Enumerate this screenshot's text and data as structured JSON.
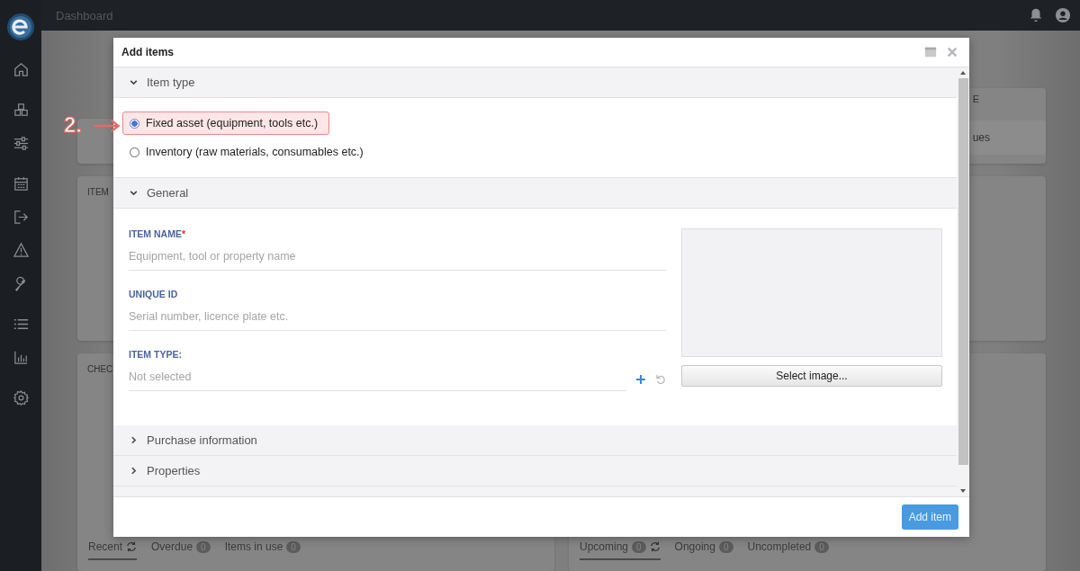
{
  "topbar": {
    "title": "Dashboard"
  },
  "dashboard": {
    "right_title": "E",
    "right_bar_text": "ues",
    "panels": [
      {
        "title": "ITEM"
      },
      {
        "title": "CHEC"
      }
    ],
    "tab_groups": [
      {
        "tabs": [
          {
            "label": "Recent",
            "selected": true,
            "refresh": true
          },
          {
            "label": "Overdue",
            "badge": "0",
            "selected": false,
            "refresh": false
          },
          {
            "label": "Items in use",
            "badge": "0",
            "selected": false,
            "refresh": false
          }
        ]
      },
      {
        "tabs": [
          {
            "label": "Upcoming",
            "badge": "0",
            "selected": true,
            "refresh": true
          },
          {
            "label": "Ongoing",
            "badge": "0",
            "selected": false,
            "refresh": false
          },
          {
            "label": "Uncompleted",
            "badge": "0",
            "selected": false,
            "refresh": false
          }
        ]
      }
    ]
  },
  "modal": {
    "title": "Add items",
    "sections": [
      {
        "title": "Item type",
        "expanded": true,
        "kind": "choice",
        "options": [
          {
            "label": "Fixed asset (equipment, tools etc.)",
            "selected": true,
            "annotation": "2."
          },
          {
            "label": "Inventory (raw materials, consumables etc.)",
            "selected": false
          }
        ]
      },
      {
        "title": "General",
        "expanded": true,
        "kind": "form",
        "fields": [
          {
            "label": "ITEM NAME",
            "required_mark": "*",
            "kind": "text",
            "placeholder": "Equipment, tool or property name"
          },
          {
            "label": "UNIQUE ID",
            "kind": "text",
            "placeholder": "Serial number, licence plate etc."
          },
          {
            "label": "ITEM TYPE:",
            "kind": "select",
            "placeholder": "Not selected"
          }
        ],
        "image_button": "Select image..."
      },
      {
        "title": "Purchase information",
        "expanded": false
      },
      {
        "title": "Properties",
        "expanded": false
      }
    ],
    "submit": "Add item"
  }
}
